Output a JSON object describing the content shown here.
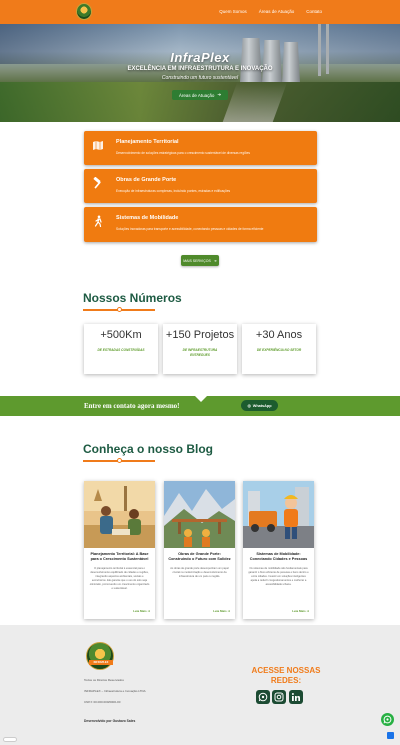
{
  "header": {
    "nav": [
      "Quem Somos",
      "Áreas de Atuação",
      "Contato"
    ]
  },
  "hero": {
    "title": "InfraPlex",
    "subtitle": "EXCELÊNCIA EM INFRAESTRUTURA E INOVAÇÃO",
    "tagline": "Construindo um futuro sustentável",
    "button": "Áreas de Atuação"
  },
  "services": [
    {
      "title": "Planejamento Territorial",
      "desc": "Desenvolvimento de soluções estratégicas para o crescimento sustentável de diversas regiões",
      "icon": "map-icon"
    },
    {
      "title": "Obras de Grande Porte",
      "desc": "Execução de infraestruturas complexas, incluindo pontes, estradas e edificações",
      "icon": "hammer-icon"
    },
    {
      "title": "Sistemas de Mobilidade",
      "desc": "Soluções inovadoras para transporte e acessibilidade, conectando pessoas e cidades de forma eficiente",
      "icon": "person-walking-icon"
    }
  ],
  "services_button": "MAIS SERVIÇOS",
  "numbers": {
    "title": "Nossos Números",
    "stats": [
      {
        "value": "+500Km",
        "label": "DE ESTRADAS CONSTRUÍDAS"
      },
      {
        "value": "+150 Projetos",
        "label": "DE INFRAESTRUTURA ENTREGUES"
      },
      {
        "value": "+30 Anos",
        "label": "DE EXPERIÊNCIA NO SETOR"
      }
    ]
  },
  "contact": {
    "text": "Entre em contato agora mesmo!",
    "button": "WhatsApp"
  },
  "blog": {
    "title": "Conheça o nosso Blog",
    "read_more": "Leia Mais",
    "posts": [
      {
        "title": "Planejamento Territorial: A Base para o Crescimento Sustentável",
        "desc": "O planejamento territorial é essencial para o desenvolvimento equilibrado de cidades e regiões, integrando aspectos ambientais, sociais e econômicos. Ele garante que o uso do solo seja otimizado, promovendo um crescimento organizado e sustentável."
      },
      {
        "title": "Obras de Grande Porte: Construindo o Futuro com Solidez",
        "desc": "As obras de grande porte desempenham um papel crucial na modernização e desenvolvimento da infraestrutura de um país ou região."
      },
      {
        "title": "Sistemas de Mobilidade: Conectando Cidades e Pessoas",
        "desc": "Os sistemas de mobilidade são fundamentais para garantir o fluxo eficiente de pessoas e bens dentro e entre cidades. Investir em soluções inteligentes ajuda a reduzir congestionamentos e melhorar a acessibilidade urbana."
      }
    ]
  },
  "footer": {
    "logo_text": "INFRAPLEX",
    "rights": "Todos os Direitos Reservados",
    "company": "INFRAPLEX – Infraestrutura e Inovação LTDA",
    "cnpj": "CNPJ: 00.000.000/0000-00",
    "dev": "Desenvolvido por Gustavo Sales",
    "social_title": "ACESSE NOSSAS REDES:",
    "social": [
      "whatsapp-icon",
      "instagram-icon",
      "linkedin-icon"
    ]
  },
  "colors": {
    "orange": "#f07b1a",
    "green": "#5e9a2e",
    "dark_green": "#1e5b43"
  }
}
